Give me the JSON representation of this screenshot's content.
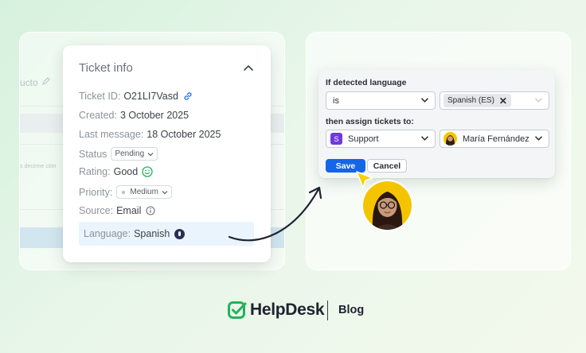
{
  "background_panel": {
    "title": "ucto",
    "snippet": "s decirme cóm"
  },
  "ticket_info": {
    "title": "Ticket info",
    "ticket_id_label": "Ticket ID:",
    "ticket_id_value": "O21LI7Vasd",
    "created_label": "Created:",
    "created_value": "3 October 2025",
    "last_message_label": "Last message:",
    "last_message_value": "18 October 2025",
    "status_label": "Status",
    "status_value": "Pending",
    "rating_label": "Rating:",
    "rating_value": "Good",
    "priority_label": "Priority:",
    "priority_value": "Medium",
    "source_label": "Source:",
    "source_value": "Email",
    "language_label": "Language:",
    "language_value": "Spanish"
  },
  "rule": {
    "condition_label": "If detected language",
    "operator_value": "is",
    "language_tag": "Spanish (ES)",
    "action_label": "then assign tickets to:",
    "team_icon_letter": "S",
    "team_value": "Support",
    "agent_value": "María Fernández",
    "save_label": "Save",
    "cancel_label": "Cancel"
  },
  "footer": {
    "brand": "HelpDesk",
    "section": "Blog"
  },
  "colors": {
    "brand_green": "#22b35b",
    "primary_blue": "#1565e8",
    "team_purple": "#6e3adb",
    "avatar_yellow": "#f5c400"
  }
}
